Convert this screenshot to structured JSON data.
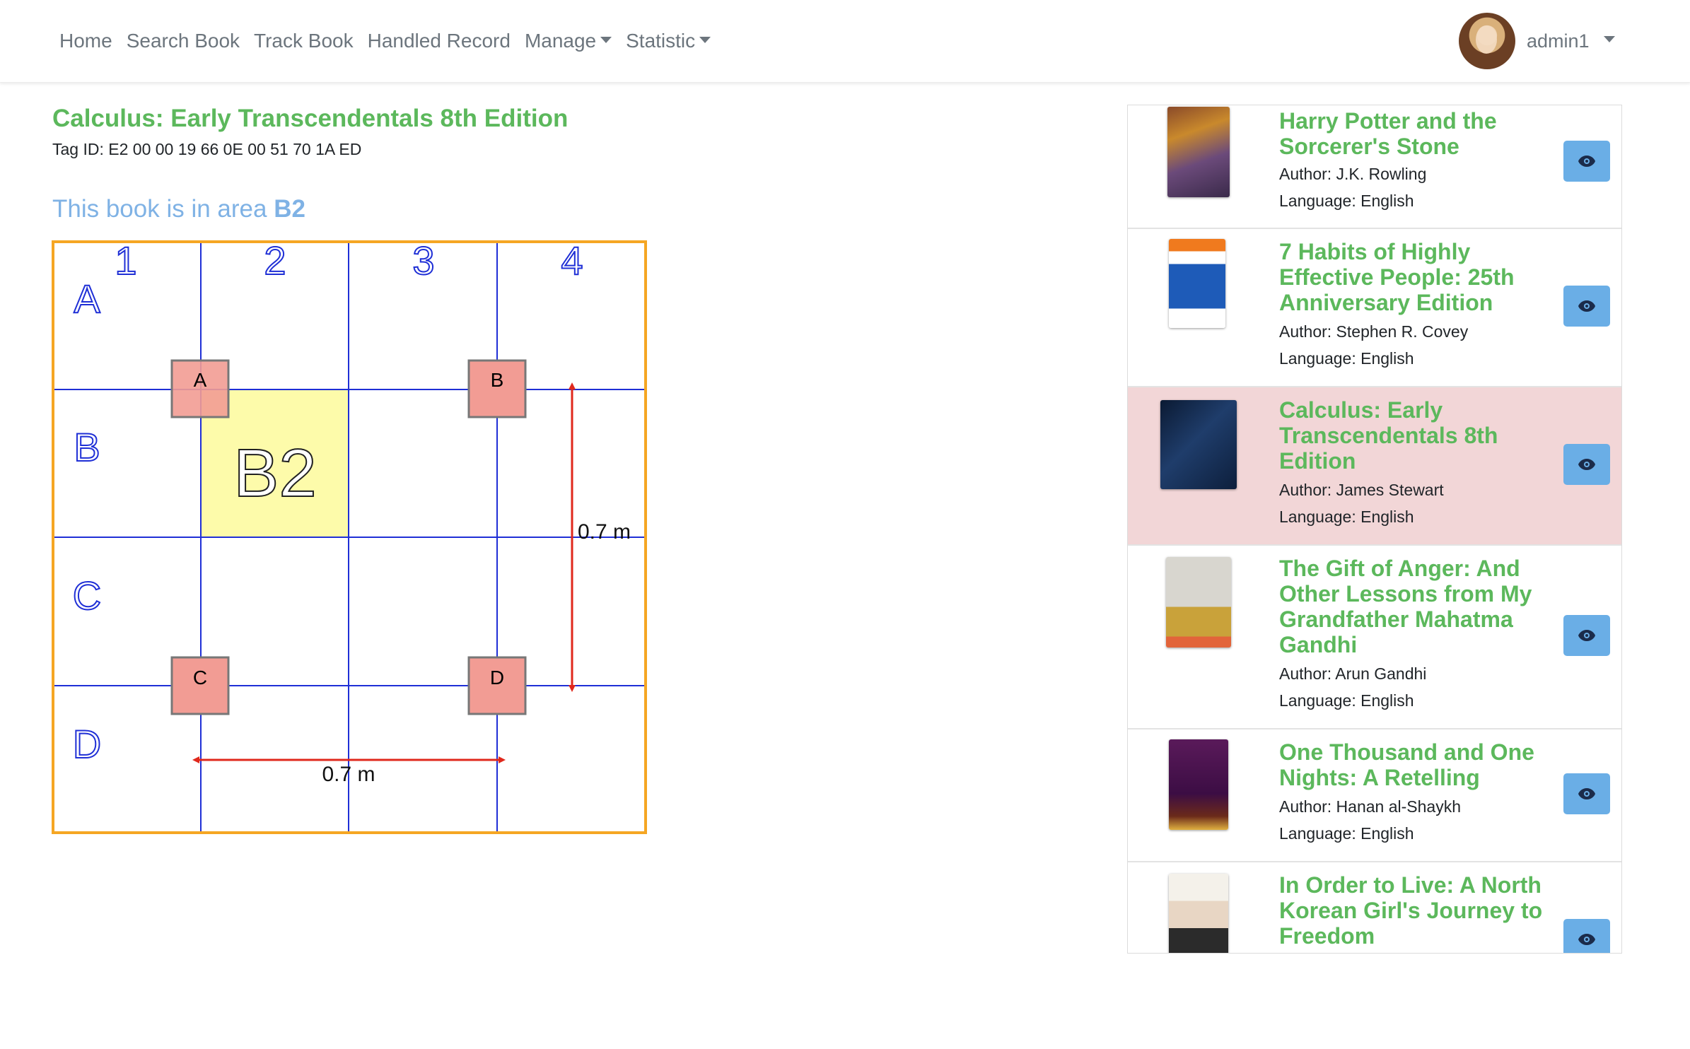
{
  "nav": {
    "links": [
      "Home",
      "Search Book",
      "Track Book",
      "Handled Record"
    ],
    "dropdowns": [
      "Manage",
      "Statistic"
    ],
    "user": "admin1"
  },
  "detail": {
    "title": "Calculus: Early Transcendentals 8th Edition",
    "tag_id": "Tag ID: E2 00 00 19 66 0E 00 51 70 1A ED",
    "area_prefix": "This book is in area",
    "area": "B2"
  },
  "map": {
    "columns": [
      "1",
      "2",
      "3",
      "4"
    ],
    "rows": [
      "A",
      "B",
      "C",
      "D"
    ],
    "highlight_label": "B2",
    "readers": [
      "A",
      "B",
      "C",
      "D"
    ],
    "dim_vertical": "0.7 m",
    "dim_horizontal": "0.7 m",
    "colors": {
      "border": "#f5a623",
      "grid": "#1f2fd6",
      "highlight": "#fdfbaa",
      "reader": "#f29c94",
      "arrow": "#e0281c"
    }
  },
  "books": [
    {
      "title": "Harry Potter and the Sorcerer's Stone",
      "author": "Author: J.K. Rowling",
      "language": "Language: English",
      "active": false
    },
    {
      "title": "7 Habits of Highly Effective People: 25th Anniversary Edition",
      "author": "Author: Stephen R. Covey",
      "language": "Language: English",
      "active": false
    },
    {
      "title": "Calculus: Early Transcendentals 8th Edition",
      "author": "Author: James Stewart",
      "language": "Language: English",
      "active": true
    },
    {
      "title": "The Gift of Anger: And Other Lessons from My Grandfather Mahatma Gandhi",
      "author": "Author: Arun Gandhi",
      "language": "Language: English",
      "active": false
    },
    {
      "title": "One Thousand and One Nights: A Retelling",
      "author": "Author: Hanan al-Shaykh",
      "language": "Language: English",
      "active": false
    },
    {
      "title": "In Order to Live: A North Korean Girl's Journey to Freedom",
      "author": "",
      "language": "",
      "active": false
    }
  ],
  "icons": {
    "view": "eye-icon"
  }
}
